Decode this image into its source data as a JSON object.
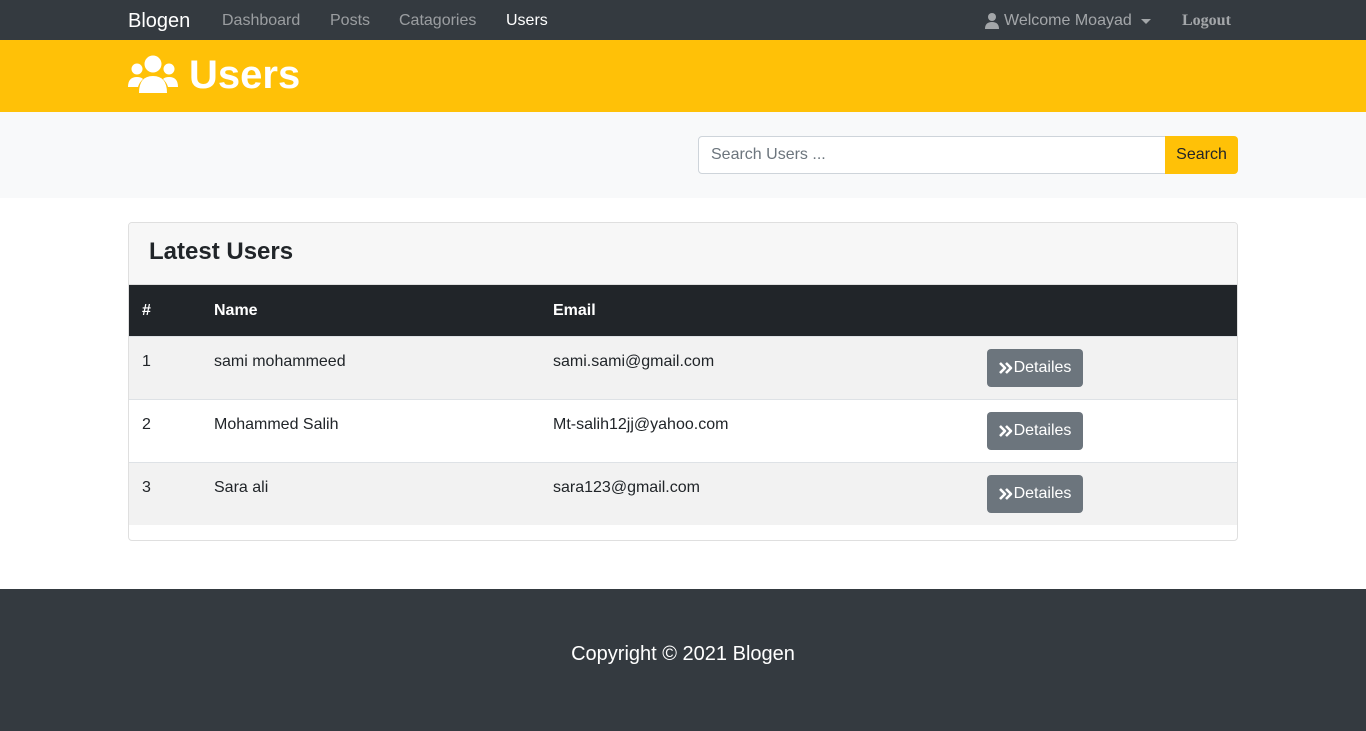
{
  "navbar": {
    "brand": "Blogen",
    "links": [
      {
        "label": "Dashboard",
        "active": false
      },
      {
        "label": "Posts",
        "active": false
      },
      {
        "label": "Catagories",
        "active": false
      },
      {
        "label": "Users",
        "active": true
      }
    ],
    "welcome": "Welcome Moayad",
    "logout": "Logout"
  },
  "header": {
    "title": "Users",
    "icon": "users-icon"
  },
  "search": {
    "placeholder": "Search Users ...",
    "value": "",
    "button": "Search"
  },
  "table": {
    "title": "Latest Users",
    "columns": [
      "#",
      "Name",
      "Email"
    ],
    "rows": [
      {
        "num": "1",
        "name": "sami mohammeed",
        "email": "sami.sami@gmail.com",
        "action": "Detailes"
      },
      {
        "num": "2",
        "name": "Mohammed Salih",
        "email": "Mt-salih12jj@yahoo.com",
        "action": "Detailes"
      },
      {
        "num": "3",
        "name": "Sara ali",
        "email": "sara123@gmail.com",
        "action": "Detailes"
      }
    ]
  },
  "footer": {
    "copyright": "Copyright © 2021 Blogen"
  },
  "colors": {
    "navbar": "#343a40",
    "accent": "#ffc107",
    "table_header": "#212529",
    "button_secondary": "#6c757d"
  }
}
